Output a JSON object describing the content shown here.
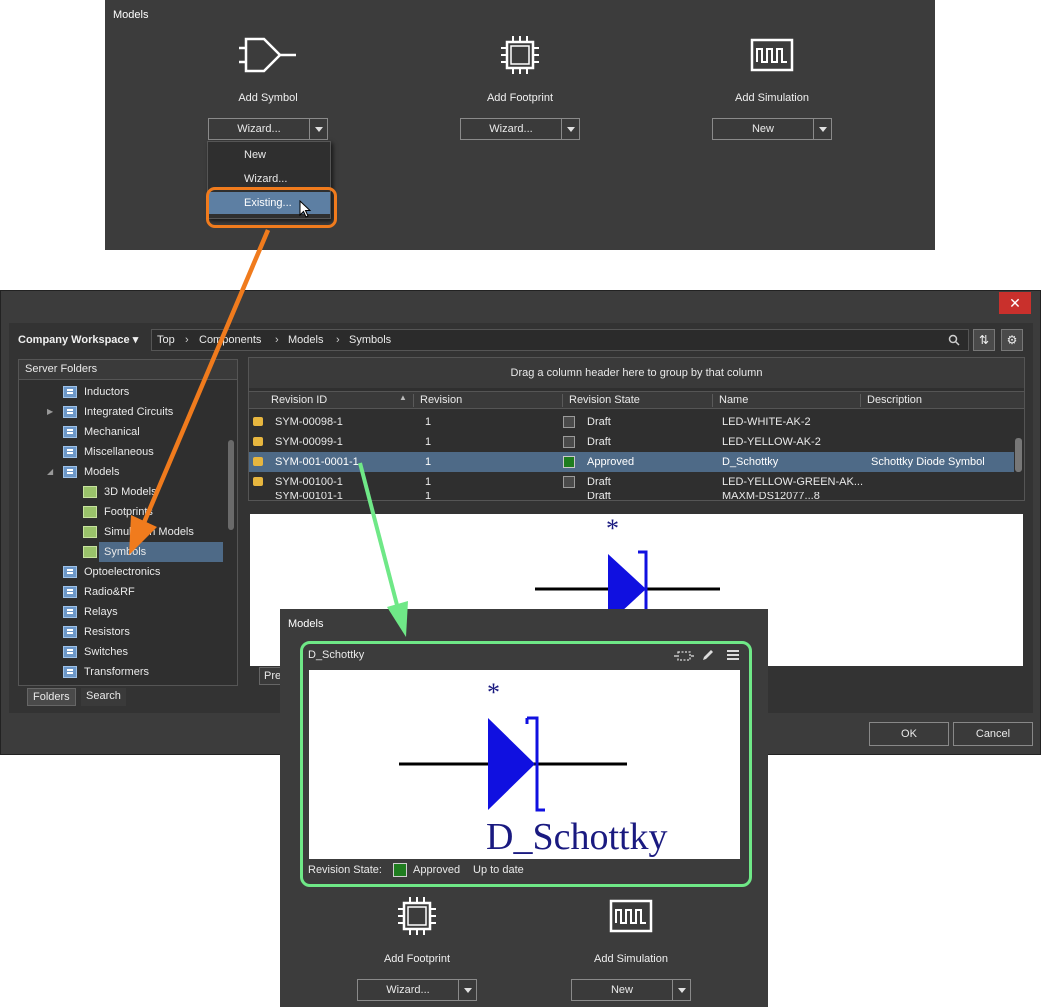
{
  "top_panel": {
    "title": "Models",
    "items": [
      {
        "label": "Add Symbol",
        "dropdown": "Wizard...",
        "icon": "symbol-gate-icon"
      },
      {
        "label": "Add Footprint",
        "dropdown": "Wizard...",
        "icon": "chip-icon"
      },
      {
        "label": "Add Simulation",
        "dropdown": "New",
        "icon": "waveform-icon"
      }
    ],
    "menu": [
      "New",
      "Wizard...",
      "Existing..."
    ]
  },
  "dialog": {
    "close": "✕",
    "workspace": "Company Workspace",
    "breadcrumb": [
      "Top",
      "Components",
      "Models",
      "Symbols"
    ],
    "tree_header": "Server Folders",
    "tree": [
      {
        "label": "Inductors",
        "level": 1
      },
      {
        "label": "Integrated Circuits",
        "level": 1
      },
      {
        "label": "Mechanical",
        "level": 1
      },
      {
        "label": "Miscellaneous",
        "level": 1
      },
      {
        "label": "Models",
        "level": 1
      },
      {
        "label": "3D Models",
        "level": 2
      },
      {
        "label": "Footprints",
        "level": 2
      },
      {
        "label": "Simulation Models",
        "level": 2
      },
      {
        "label": "Symbols",
        "level": 2
      },
      {
        "label": "Optoelectronics",
        "level": 1
      },
      {
        "label": "Radio&RF",
        "level": 1
      },
      {
        "label": "Relays",
        "level": 1
      },
      {
        "label": "Resistors",
        "level": 1
      },
      {
        "label": "Switches",
        "level": 1
      },
      {
        "label": "Transformers",
        "level": 1
      }
    ],
    "tabs": [
      "Folders",
      "Search"
    ],
    "group_hint": "Drag a column header here to group by that column",
    "columns": [
      "Revision ID",
      "Revision",
      "Revision State",
      "Name",
      "Description"
    ],
    "rows": [
      {
        "id": "SYM-00098-1",
        "rev": "1",
        "state": "Draft",
        "name": "LED-WHITE-AK-2",
        "desc": ""
      },
      {
        "id": "SYM-00099-1",
        "rev": "1",
        "state": "Draft",
        "name": "LED-YELLOW-AK-2",
        "desc": ""
      },
      {
        "id": "SYM-001-0001-1",
        "rev": "1",
        "state": "Approved",
        "name": "D_Schottky",
        "desc": "Schottky Diode Symbol"
      },
      {
        "id": "SYM-00100-1",
        "rev": "1",
        "state": "Draft",
        "name": "LED-YELLOW-GREEN-AK...",
        "desc": ""
      },
      {
        "id": "SYM-00101-1",
        "rev": "1",
        "state": "Draft",
        "name": "MAXM-DS12077...8",
        "desc": ""
      }
    ],
    "preview_tab": "Pre",
    "ok": "OK",
    "cancel": "Cancel"
  },
  "bottom_panel": {
    "title": "Models",
    "card_name": "D_Schottky",
    "preview_label": "D_Schottky",
    "designator": "*",
    "revision_state_label": "Revision State:",
    "revision_state": "Approved",
    "status": "Up to date",
    "items": [
      {
        "label": "Add Footprint",
        "dropdown": "Wizard...",
        "icon": "chip-icon"
      },
      {
        "label": "Add Simulation",
        "dropdown": "New",
        "icon": "waveform-icon"
      }
    ]
  },
  "colors": {
    "panel_bg": "#3c3c3c",
    "highlight": "#5d7fa3",
    "orange_callout": "#f07b1d",
    "green_callout": "#6fe887",
    "symbol_blue": "#1010e0",
    "approved": "#1f7d1f",
    "close_red": "#c9302c"
  }
}
